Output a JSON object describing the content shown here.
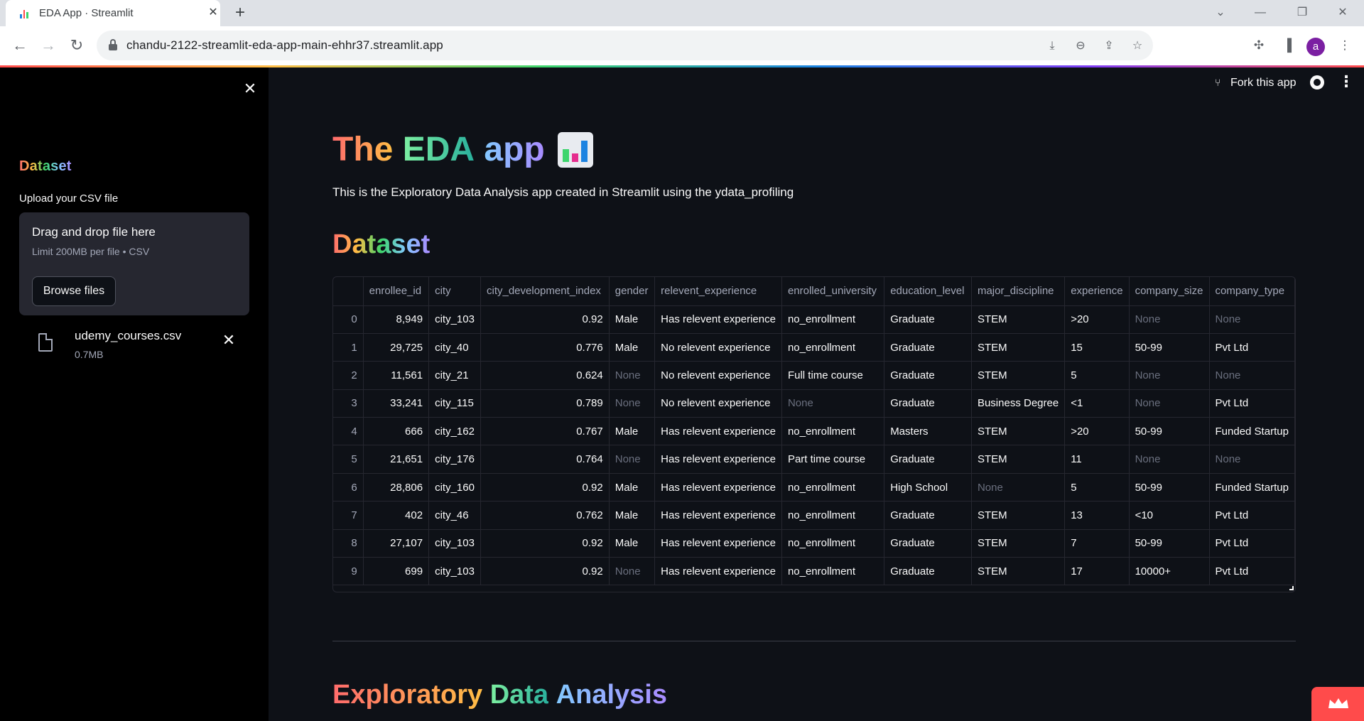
{
  "browser": {
    "tab_title": "EDA App · Streamlit",
    "url": "chandu-2122-streamlit-eda-app-main-ehhr37.streamlit.app",
    "profile_initial": "a"
  },
  "sidebar": {
    "heading": "Dataset",
    "upload_label": "Upload your CSV file",
    "dropzone_title": "Drag and drop file here",
    "dropzone_limit": "Limit 200MB per file • CSV",
    "browse_label": "Browse files",
    "file_name": "udemy_courses.csv",
    "file_size": "0.7MB"
  },
  "header": {
    "fork_label": "Fork this app"
  },
  "main": {
    "title_words": [
      "The",
      "EDA",
      "app"
    ],
    "intro": "This is the Exploratory Data Analysis app created in Streamlit using the ydata_profiling",
    "dataset_heading": "Dataset",
    "eda_heading_words": [
      "Exploratory",
      "Data",
      "Analysis"
    ]
  },
  "table": {
    "columns": [
      "",
      "enrollee_id",
      "city",
      "city_development_index",
      "gender",
      "relevent_experience",
      "enrolled_university",
      "education_level",
      "major_discipline",
      "experience",
      "company_size",
      "company_type"
    ],
    "rows": [
      [
        "0",
        "8,949",
        "city_103",
        "0.92",
        "Male",
        "Has relevent experience",
        "no_enrollment",
        "Graduate",
        "STEM",
        ">20",
        "None",
        "None"
      ],
      [
        "1",
        "29,725",
        "city_40",
        "0.776",
        "Male",
        "No relevent experience",
        "no_enrollment",
        "Graduate",
        "STEM",
        "15",
        "50-99",
        "Pvt Ltd"
      ],
      [
        "2",
        "11,561",
        "city_21",
        "0.624",
        "None",
        "No relevent experience",
        "Full time course",
        "Graduate",
        "STEM",
        "5",
        "None",
        "None"
      ],
      [
        "3",
        "33,241",
        "city_115",
        "0.789",
        "None",
        "No relevent experience",
        "None",
        "Graduate",
        "Business Degree",
        "<1",
        "None",
        "Pvt Ltd"
      ],
      [
        "4",
        "666",
        "city_162",
        "0.767",
        "Male",
        "Has relevent experience",
        "no_enrollment",
        "Masters",
        "STEM",
        ">20",
        "50-99",
        "Funded Startup"
      ],
      [
        "5",
        "21,651",
        "city_176",
        "0.764",
        "None",
        "Has relevent experience",
        "Part time course",
        "Graduate",
        "STEM",
        "11",
        "None",
        "None"
      ],
      [
        "6",
        "28,806",
        "city_160",
        "0.92",
        "Male",
        "Has relevent experience",
        "no_enrollment",
        "High School",
        "None",
        "5",
        "50-99",
        "Funded Startup"
      ],
      [
        "7",
        "402",
        "city_46",
        "0.762",
        "Male",
        "Has relevent experience",
        "no_enrollment",
        "Graduate",
        "STEM",
        "13",
        "<10",
        "Pvt Ltd"
      ],
      [
        "8",
        "27,107",
        "city_103",
        "0.92",
        "Male",
        "Has relevent experience",
        "no_enrollment",
        "Graduate",
        "STEM",
        "7",
        "50-99",
        "Pvt Ltd"
      ],
      [
        "9",
        "699",
        "city_103",
        "0.92",
        "None",
        "Has relevent experience",
        "no_enrollment",
        "Graduate",
        "STEM",
        "17",
        "10000+",
        "Pvt Ltd"
      ]
    ]
  },
  "colors": {
    "accent": "#ff4b4b",
    "background": "#0e1117",
    "sidebar": "#000000"
  }
}
